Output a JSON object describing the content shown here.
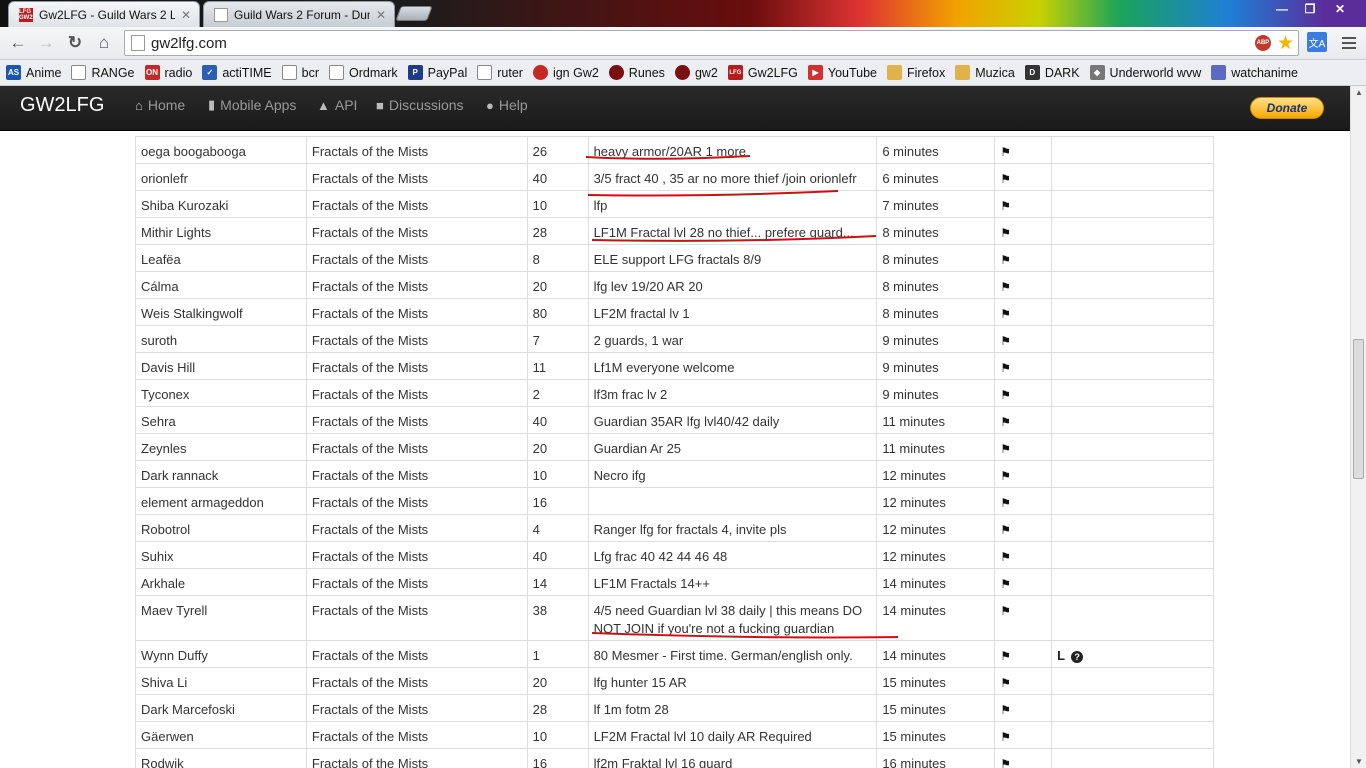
{
  "browser": {
    "tabs": [
      {
        "title": "Gw2LFG - Guild Wars 2 Lo",
        "icon": "lfg-favicon-icon",
        "icon_text": "LFG GW2"
      },
      {
        "title": "Guild Wars 2 Forum - Dun",
        "icon": "page-icon"
      }
    ],
    "url": "gw2lfg.com",
    "bookmarks": [
      {
        "label": "Anime",
        "icon": "as-icon",
        "icon_text": "AS",
        "color": "#1a56b0"
      },
      {
        "label": "RANGe",
        "icon": "page-icon",
        "color": "#ffffff"
      },
      {
        "label": "radio",
        "icon": "onlineradio-icon",
        "icon_text": "ON",
        "color": "#c62828"
      },
      {
        "label": "actiTIME",
        "icon": "actitime-icon",
        "color": "#2c5fb3"
      },
      {
        "label": "bcr",
        "icon": "page-icon",
        "color": "#ffffff"
      },
      {
        "label": "Ordmark",
        "icon": "page-icon",
        "color": "#ffffff"
      },
      {
        "label": "PayPal",
        "icon": "paypal-icon",
        "icon_text": "P",
        "color": "#1f3c88"
      },
      {
        "label": "ruter",
        "icon": "page-icon",
        "color": "#ffffff"
      },
      {
        "label": "ign Gw2",
        "icon": "ign-icon",
        "color": "#c62828"
      },
      {
        "label": "Runes",
        "icon": "gw2-icon",
        "color": "#7a1010"
      },
      {
        "label": "gw2",
        "icon": "gw2-icon",
        "color": "#7a1010"
      },
      {
        "label": "Gw2LFG",
        "icon": "lfg-icon",
        "icon_text": "LFG",
        "color": "#b71c1c"
      },
      {
        "label": "YouTube",
        "icon": "youtube-icon",
        "color": "#d32f2f"
      },
      {
        "label": "Firefox",
        "icon": "folder-icon",
        "color": "#e0b34a"
      },
      {
        "label": "Muzica",
        "icon": "folder-icon",
        "color": "#e0b34a"
      },
      {
        "label": "DARK",
        "icon": "dark-icon",
        "icon_text": "D",
        "color": "#333333"
      },
      {
        "label": "Underworld wvw",
        "icon": "underworld-icon",
        "color": "#777777"
      },
      {
        "label": "watchanime",
        "icon": "watchanime-icon",
        "color": "#5c6bc0"
      }
    ]
  },
  "site": {
    "brand": "GW2LFG",
    "nav": [
      {
        "label": "Home",
        "icon": "home-icon"
      },
      {
        "label": "Mobile Apps",
        "icon": "signal-icon"
      },
      {
        "label": "API",
        "icon": "chevron-up-icon"
      },
      {
        "label": "Discussions",
        "icon": "chat-icon"
      },
      {
        "label": "Help",
        "icon": "question-icon"
      }
    ],
    "donate": "Donate"
  },
  "listings": [
    {
      "name": "oega boogabooga",
      "dungeon": "Fractals of the Mists",
      "level": "26",
      "message": "heavy armor/20AR 1 more",
      "time": "6 minutes",
      "extra": ""
    },
    {
      "name": "orionlefr",
      "dungeon": "Fractals of the Mists",
      "level": "40",
      "message": "3/5 fract 40 , 35 ar no more thief /join orionlefr",
      "time": "6 minutes",
      "extra": ""
    },
    {
      "name": "Shiba Kurozaki",
      "dungeon": "Fractals of the Mists",
      "level": "10",
      "message": "lfp",
      "time": "7 minutes",
      "extra": ""
    },
    {
      "name": "Mithir Lights",
      "dungeon": "Fractals of the Mists",
      "level": "28",
      "message": "LF1M Fractal lvl 28 no thief... prefere guard...",
      "time": "8 minutes",
      "extra": ""
    },
    {
      "name": "Leafëa",
      "dungeon": "Fractals of the Mists",
      "level": "8",
      "message": "ELE support LFG fractals 8/9",
      "time": "8 minutes",
      "extra": ""
    },
    {
      "name": "Cálma",
      "dungeon": "Fractals of the Mists",
      "level": "20",
      "message": "lfg lev 19/20 AR 20",
      "time": "8 minutes",
      "extra": ""
    },
    {
      "name": "Weis Stalkingwolf",
      "dungeon": "Fractals of the Mists",
      "level": "80",
      "message": "LF2M fractal lv 1",
      "time": "8 minutes",
      "extra": ""
    },
    {
      "name": "suroth",
      "dungeon": "Fractals of the Mists",
      "level": "7",
      "message": "2 guards, 1 war",
      "time": "9 minutes",
      "extra": ""
    },
    {
      "name": "Davis Hill",
      "dungeon": "Fractals of the Mists",
      "level": "11",
      "message": "Lf1M everyone welcome",
      "time": "9 minutes",
      "extra": ""
    },
    {
      "name": "Tyconex",
      "dungeon": "Fractals of the Mists",
      "level": "2",
      "message": "lf3m frac lv 2",
      "time": "9 minutes",
      "extra": ""
    },
    {
      "name": "Sehra",
      "dungeon": "Fractals of the Mists",
      "level": "40",
      "message": "Guardian 35AR lfg lvl40/42 daily",
      "time": "11 minutes",
      "extra": ""
    },
    {
      "name": "Zeynles",
      "dungeon": "Fractals of the Mists",
      "level": "20",
      "message": "Guardian Ar 25",
      "time": "11 minutes",
      "extra": ""
    },
    {
      "name": "Dark rannack",
      "dungeon": "Fractals of the Mists",
      "level": "10",
      "message": "Necro ifg",
      "time": "12 minutes",
      "extra": ""
    },
    {
      "name": "element armageddon",
      "dungeon": "Fractals of the Mists",
      "level": "16",
      "message": "",
      "time": "12 minutes",
      "extra": ""
    },
    {
      "name": "Robotrol",
      "dungeon": "Fractals of the Mists",
      "level": "4",
      "message": "Ranger lfg for fractals 4, invite pls",
      "time": "12 minutes",
      "extra": ""
    },
    {
      "name": "Suhix",
      "dungeon": "Fractals of the Mists",
      "level": "40",
      "message": "Lfg frac 40 42 44 46 48",
      "time": "12 minutes",
      "extra": ""
    },
    {
      "name": "Arkhale",
      "dungeon": "Fractals of the Mists",
      "level": "14",
      "message": "LF1M Fractals 14++",
      "time": "14 minutes",
      "extra": ""
    },
    {
      "name": "Maev Tyrell",
      "dungeon": "Fractals of the Mists",
      "level": "38",
      "message": "4/5 need Guardian lvl 38 daily | this means DO NOT JOIN if you're not a fucking guardian",
      "time": "14 minutes",
      "extra": ""
    },
    {
      "name": "Wynn Duffy",
      "dungeon": "Fractals of the Mists",
      "level": "1",
      "message": "80 Mesmer - First time. German/english only.",
      "time": "14 minutes",
      "extra": "L"
    },
    {
      "name": "Shiva Li",
      "dungeon": "Fractals of the Mists",
      "level": "20",
      "message": "lfg hunter 15 AR",
      "time": "15 minutes",
      "extra": ""
    },
    {
      "name": "Dark Marcefoski",
      "dungeon": "Fractals of the Mists",
      "level": "28",
      "message": "lf 1m fotm 28",
      "time": "15 minutes",
      "extra": ""
    },
    {
      "name": "Gäerwen",
      "dungeon": "Fractals of the Mists",
      "level": "10",
      "message": "LF2M Fractal lvl 10 daily AR Required",
      "time": "15 minutes",
      "extra": ""
    },
    {
      "name": "Rodwik",
      "dungeon": "Fractals of the Mists",
      "level": "16",
      "message": "lf2m Fraktal lvl 16 guard",
      "time": "16 minutes",
      "extra": ""
    }
  ],
  "colors": {
    "annotation": "#d01010",
    "navbar": "#222222",
    "accent_donate": "#f6a800"
  }
}
